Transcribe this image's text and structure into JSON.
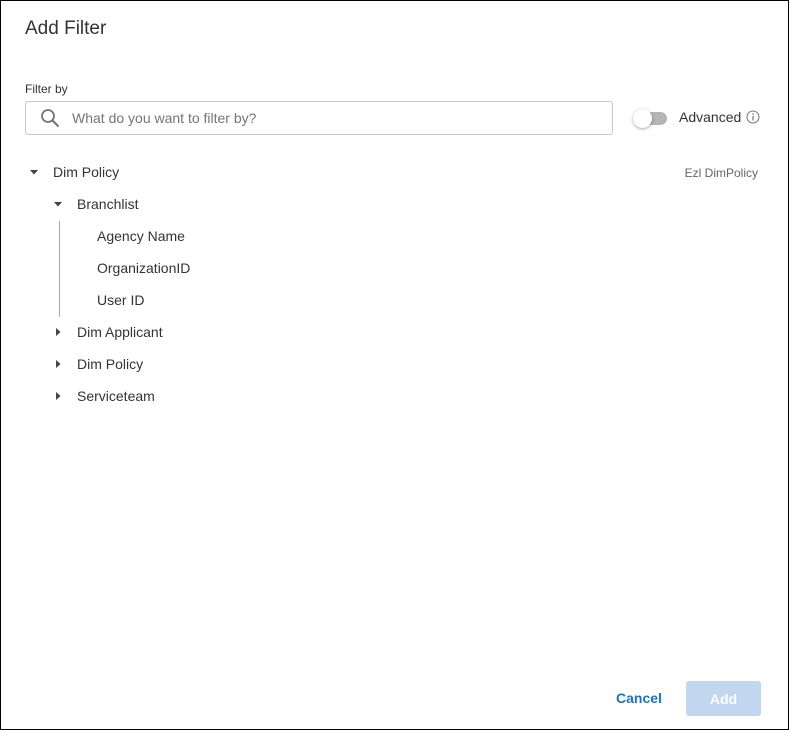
{
  "dialog": {
    "title": "Add Filter",
    "filter_label": "Filter by",
    "search": {
      "placeholder": "What do you want to filter by?",
      "value": ""
    },
    "advanced": {
      "label": "Advanced",
      "enabled": false
    },
    "tree": {
      "root": {
        "label": "Dim Policy",
        "source": "Ezl DimPolicy",
        "expanded": true,
        "children": [
          {
            "label": "Branchlist",
            "expanded": true,
            "children": [
              {
                "label": "Agency Name"
              },
              {
                "label": "OrganizationID"
              },
              {
                "label": "User ID"
              }
            ]
          },
          {
            "label": "Dim Applicant",
            "expanded": false
          },
          {
            "label": "Dim Policy",
            "expanded": false
          },
          {
            "label": "Serviceteam",
            "expanded": false
          }
        ]
      }
    },
    "footer": {
      "cancel_label": "Cancel",
      "add_label": "Add",
      "add_enabled": false
    }
  },
  "icons": {
    "search": "search-icon",
    "info": "info-icon",
    "expanded": "caret-down-icon",
    "collapsed": "caret-right-icon"
  },
  "colors": {
    "accent": "#1a73c8",
    "add_disabled": "#c3d6f0",
    "guide_line": "#8aa8d8",
    "toggle_off": "#b5b5b5"
  }
}
